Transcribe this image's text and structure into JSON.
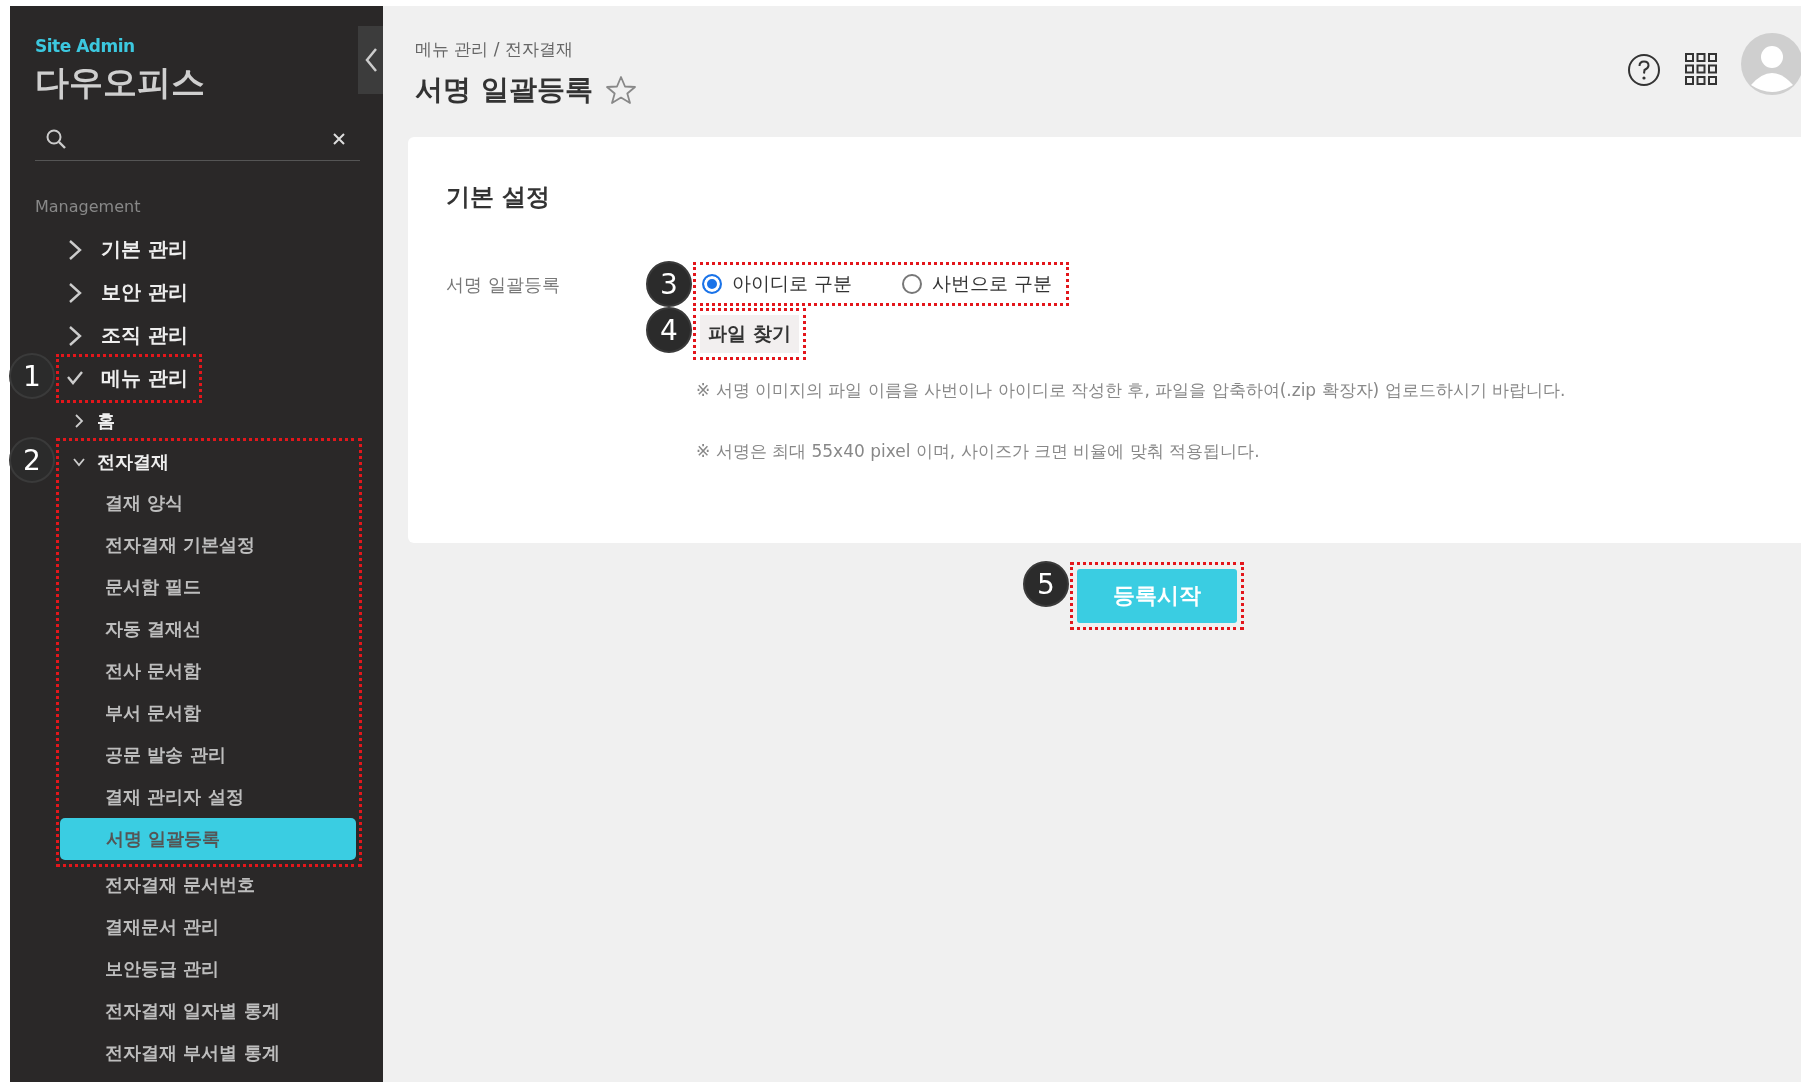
{
  "sidebar": {
    "brand": "Site Admin",
    "title": "다우오피스",
    "section": "Management",
    "items": [
      {
        "label": "기본 관리",
        "expanded": false
      },
      {
        "label": "보안 관리",
        "expanded": false
      },
      {
        "label": "조직 관리",
        "expanded": false
      },
      {
        "label": "메뉴 관리",
        "expanded": true,
        "callout": "1",
        "children": [
          {
            "label": "홈",
            "expanded": false
          },
          {
            "label": "전자결재",
            "expanded": true,
            "callout": "2",
            "children": [
              {
                "label": "결재 양식",
                "selected": false,
                "boxed": true
              },
              {
                "label": "전자결재 기본설정",
                "selected": false,
                "boxed": true
              },
              {
                "label": "문서함 필드",
                "selected": false,
                "boxed": true
              },
              {
                "label": "자동 결재선",
                "selected": false,
                "boxed": true
              },
              {
                "label": "전사 문서함",
                "selected": false,
                "boxed": true
              },
              {
                "label": "부서 문서함",
                "selected": false,
                "boxed": true
              },
              {
                "label": "공문 발송 관리",
                "selected": false,
                "boxed": true
              },
              {
                "label": "결재 관리자 설정",
                "selected": false,
                "boxed": true
              },
              {
                "label": "서명 일괄등록",
                "selected": true,
                "boxed": true
              },
              {
                "label": "전자결재 문서번호",
                "selected": false,
                "boxed": false
              },
              {
                "label": "결재문서 관리",
                "selected": false,
                "boxed": false
              },
              {
                "label": "보안등급 관리",
                "selected": false,
                "boxed": false
              },
              {
                "label": "전자결재 일자별 통계",
                "selected": false,
                "boxed": false
              },
              {
                "label": "전자결재 부서별 통계",
                "selected": false,
                "boxed": false
              }
            ]
          }
        ]
      }
    ]
  },
  "header": {
    "breadcrumb": "메뉴 관리 / 전자결재",
    "title": "서명 일괄등록",
    "favorite": false
  },
  "card": {
    "title": "기본 설정",
    "field_label": "서명 일괄등록",
    "radios": {
      "callout": "3",
      "options": [
        {
          "label": "아이디로 구분",
          "selected": true
        },
        {
          "label": "사번으로 구분",
          "selected": false
        }
      ]
    },
    "file_button": {
      "label": "파일 찾기",
      "callout": "4"
    },
    "notes": [
      "※ 서명 이미지의 파일 이름을 사번이나 아이디로 작성한 후, 파일을 압축하여(.zip 확장자) 업로드하시기 바랍니다.",
      "※ 서명은 최대 55x40 pixel 이며, 사이즈가 크면 비율에 맞춰 적용됩니다."
    ]
  },
  "submit": {
    "label": "등록시작",
    "callout": "5"
  }
}
